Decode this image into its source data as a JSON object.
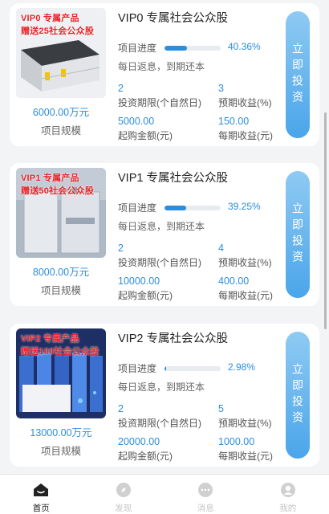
{
  "products": [
    {
      "promo_line1": "VIP0  专属产品",
      "promo_line2": "赠送25社会公众股",
      "scale_value": "6000.00万元",
      "scale_label": "项目规模",
      "title": "VIP0 专属社会公众股",
      "progress_label": "项目进度",
      "progress_pct": "40.36%",
      "progress_fraction": 0.4036,
      "repay_text": "每日返息，到期还本",
      "period_value": "2",
      "period_label": "投资期限(个自然日)",
      "yield_value": "3",
      "yield_label": "预期收益(%)",
      "min_amount_value": "5000.00",
      "min_amount_label": "起购金额(元)",
      "period_income_value": "150.00",
      "period_income_label": "每期收益(元)",
      "buy_label": "立即投资"
    },
    {
      "promo_line1": "VIP1  专属产品",
      "promo_line2": "赠送50社会公众股",
      "scale_value": "8000.00万元",
      "scale_label": "项目规模",
      "title": "VIP1 专属社会公众股",
      "progress_label": "项目进度",
      "progress_pct": "39.25%",
      "progress_fraction": 0.3925,
      "repay_text": "每日返息，到期还本",
      "period_value": "2",
      "period_label": "投资期限(个自然日)",
      "yield_value": "4",
      "yield_label": "预期收益(%)",
      "min_amount_value": "10000.00",
      "min_amount_label": "起购金额(元)",
      "period_income_value": "400.00",
      "period_income_label": "每期收益(元)",
      "buy_label": "立即投资"
    },
    {
      "promo_line1": "VIP2  专属产品",
      "promo_line2": "赠送100社会公众股",
      "scale_value": "13000.00万元",
      "scale_label": "项目规模",
      "title": "VIP2 专属社会公众股",
      "progress_label": "项目进度",
      "progress_pct": "2.98%",
      "progress_fraction": 0.0298,
      "repay_text": "每日返息，到期还本",
      "period_value": "2",
      "period_label": "投资期限(个自然日)",
      "yield_value": "5",
      "yield_label": "预期收益(%)",
      "min_amount_value": "20000.00",
      "min_amount_label": "起购金额(元)",
      "period_income_value": "1000.00",
      "period_income_label": "每期收益(元)",
      "buy_label": "立即投资"
    }
  ],
  "tabbar": {
    "items": [
      {
        "label": "首页",
        "icon": "home-icon",
        "active": true
      },
      {
        "label": "发现",
        "icon": "compass-icon",
        "active": false
      },
      {
        "label": "消息",
        "icon": "message-icon",
        "active": false
      },
      {
        "label": "我的",
        "icon": "user-icon",
        "active": false
      }
    ]
  },
  "colors": {
    "accent": "#2b8ddc",
    "promo_red": "#e8262b",
    "button_top": "#8fcaf3",
    "button_bottom": "#4aa5ea"
  }
}
